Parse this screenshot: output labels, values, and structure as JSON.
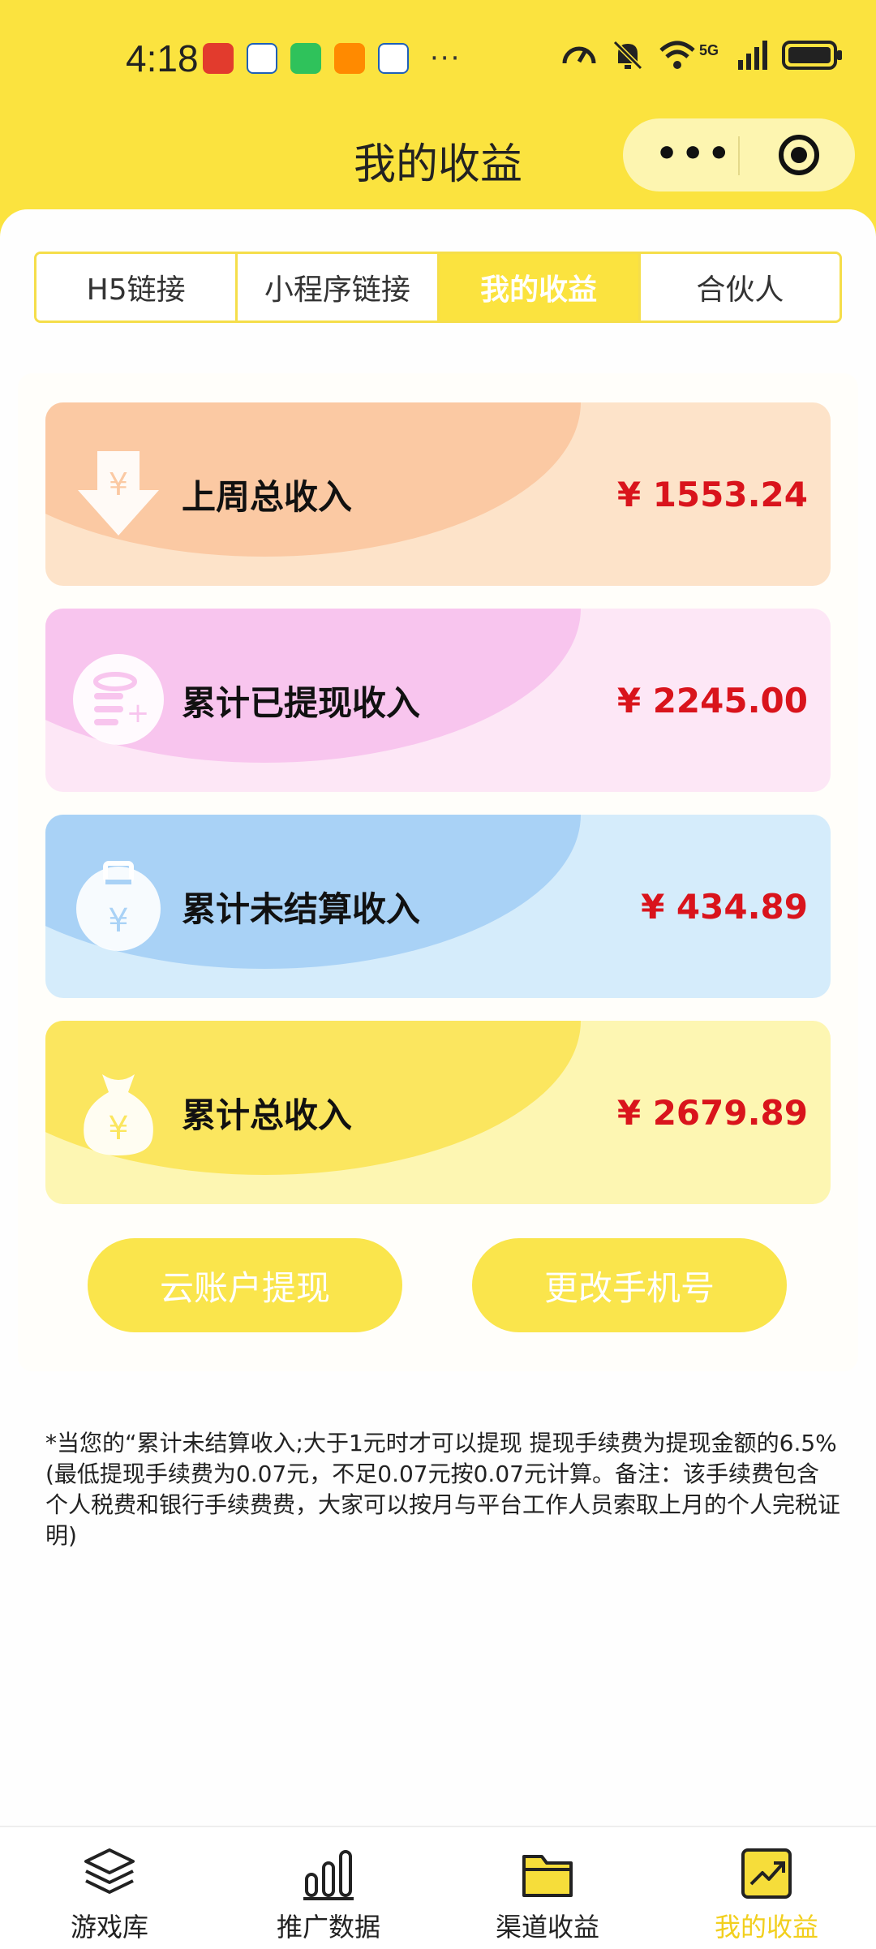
{
  "status_bar": {
    "time": "4:18",
    "dots": "···",
    "network": "5G",
    "icons": [
      "speed-icon",
      "mute-icon",
      "wifi-icon",
      "signal-icon",
      "battery-icon"
    ]
  },
  "header": {
    "title": "我的收益",
    "menu_dots": "•••"
  },
  "tabs": [
    {
      "label": "H5链接"
    },
    {
      "label": "小程序链接"
    },
    {
      "label": "我的收益",
      "active": true
    },
    {
      "label": "合伙人"
    }
  ],
  "income": [
    {
      "label": "上周总收入",
      "amount": "¥ 1553.24",
      "icon": "download-yen-icon"
    },
    {
      "label": "累计已提现收入",
      "amount": "¥ 2245.00",
      "icon": "coins-icon"
    },
    {
      "label": "累计未结算收入",
      "amount": "¥ 434.89",
      "icon": "yen-bag-icon"
    },
    {
      "label": "累计总收入",
      "amount": "¥ 2679.89",
      "icon": "money-bag-icon"
    }
  ],
  "buttons": {
    "withdraw": "云账户提现",
    "change_phone": "更改手机号"
  },
  "note": "*当您的“累计未结算收入;大于1元时才可以提现 提现手续费为提现金额的6.5%(最低提现手续费为0.07元，不足0.07元按0.07元计算。备注：该手续费包含个人税费和银行手续费费，大家可以按月与平台工作人员索取上月的个人完税证明)",
  "nav": [
    {
      "label": "游戏库",
      "icon": "layers-icon"
    },
    {
      "label": "推广数据",
      "icon": "bar-chart-icon"
    },
    {
      "label": "渠道收益",
      "icon": "folder-icon"
    },
    {
      "label": "我的收益",
      "icon": "trend-chart-icon",
      "active": true
    }
  ],
  "colors": {
    "brand_yellow": "#fbe33f",
    "amount_red": "#d9141c",
    "active_nav": "#f2cf1d"
  }
}
